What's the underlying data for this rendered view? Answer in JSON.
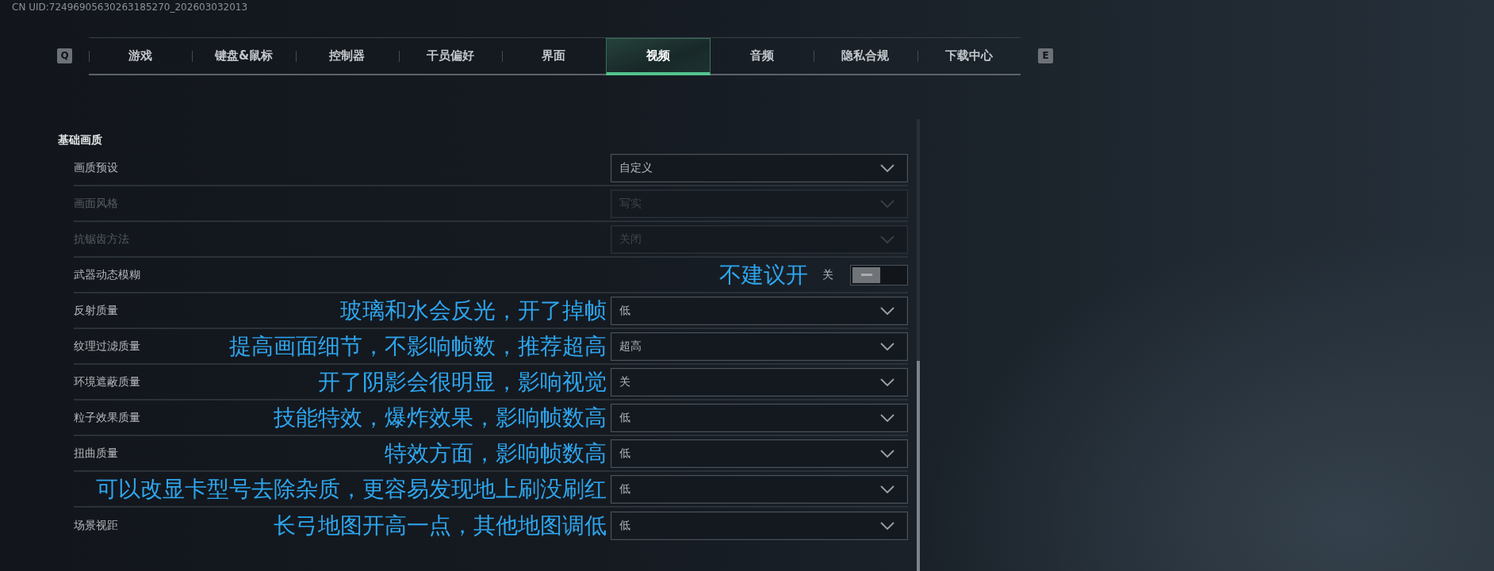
{
  "header": {
    "uid": "CN UID:72496905630263185270_202603032013"
  },
  "tabs": {
    "prev_key": "Q",
    "items": [
      {
        "label": "游戏",
        "selected": false
      },
      {
        "label": "键盘&鼠标",
        "selected": false
      },
      {
        "label": "控制器",
        "selected": false
      },
      {
        "label": "干员偏好",
        "selected": false
      },
      {
        "label": "界面",
        "selected": false
      },
      {
        "label": "视频",
        "selected": true
      },
      {
        "label": "音频",
        "selected": false
      },
      {
        "label": "隐私合规",
        "selected": false
      },
      {
        "label": "下载中心",
        "selected": false
      }
    ],
    "next_key": "E"
  },
  "section": {
    "title": "基础画质",
    "rows": [
      {
        "kind": "dropdown",
        "label": "画质预设",
        "value": "自定义",
        "disabled": false
      },
      {
        "kind": "dropdown",
        "label": "画面风格",
        "value": "写实",
        "disabled": true
      },
      {
        "kind": "dropdown",
        "label": "抗锯齿方法",
        "value": "关闭",
        "disabled": true
      },
      {
        "kind": "toggle",
        "label": "武器动态模糊",
        "note": "不建议开",
        "state_label": "关",
        "on": false,
        "disabled": false
      },
      {
        "kind": "dropdown",
        "label": "反射质量",
        "note": "玻璃和水会反光，开了掉帧",
        "value": "低",
        "disabled": false
      },
      {
        "kind": "dropdown",
        "label": "纹理过滤质量",
        "note": "提高画面细节，不影响帧数，推荐超高",
        "value": "超高",
        "disabled": false
      },
      {
        "kind": "dropdown",
        "label": "环境遮蔽质量",
        "note": "开了阴影会很明显，影响视觉",
        "value": "关",
        "disabled": false
      },
      {
        "kind": "dropdown",
        "label": "粒子效果质量",
        "note": "技能特效，爆炸效果，影响帧数高",
        "value": "低",
        "disabled": false
      },
      {
        "kind": "dropdown",
        "label": "扭曲质量",
        "note": "特效方面，影响帧数高",
        "value": "低",
        "disabled": false
      },
      {
        "kind": "dropdown",
        "note": "可以改显卡型号去除杂质，更容易发现地上刷没刷红",
        "value": "低",
        "disabled": false
      },
      {
        "kind": "dropdown",
        "label": "场景视距",
        "note": "长弓地图开高一点，其他地图调低",
        "value": "低",
        "disabled": false
      }
    ]
  }
}
